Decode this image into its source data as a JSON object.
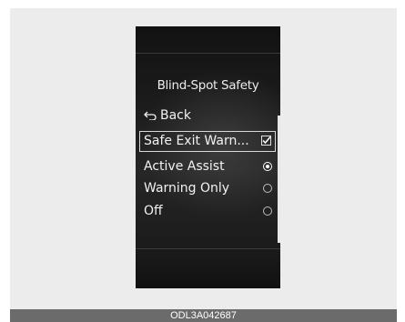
{
  "screen": {
    "title": "Blind-Spot Safety",
    "back_label": "Back",
    "menu_items": [
      {
        "label": "Safe Exit Warn...",
        "control": "checkbox",
        "checked": true,
        "highlighted": true
      },
      {
        "label": "Active Assist",
        "control": "radio",
        "selected": true
      },
      {
        "label": "Warning Only",
        "control": "radio",
        "selected": false
      },
      {
        "label": "Off",
        "control": "radio",
        "selected": false
      }
    ]
  },
  "caption": "ODL3A042687",
  "colors": {
    "screen_background": "#151515",
    "text": "#f2f2f2",
    "caption_bar": "#6b6b6b"
  }
}
